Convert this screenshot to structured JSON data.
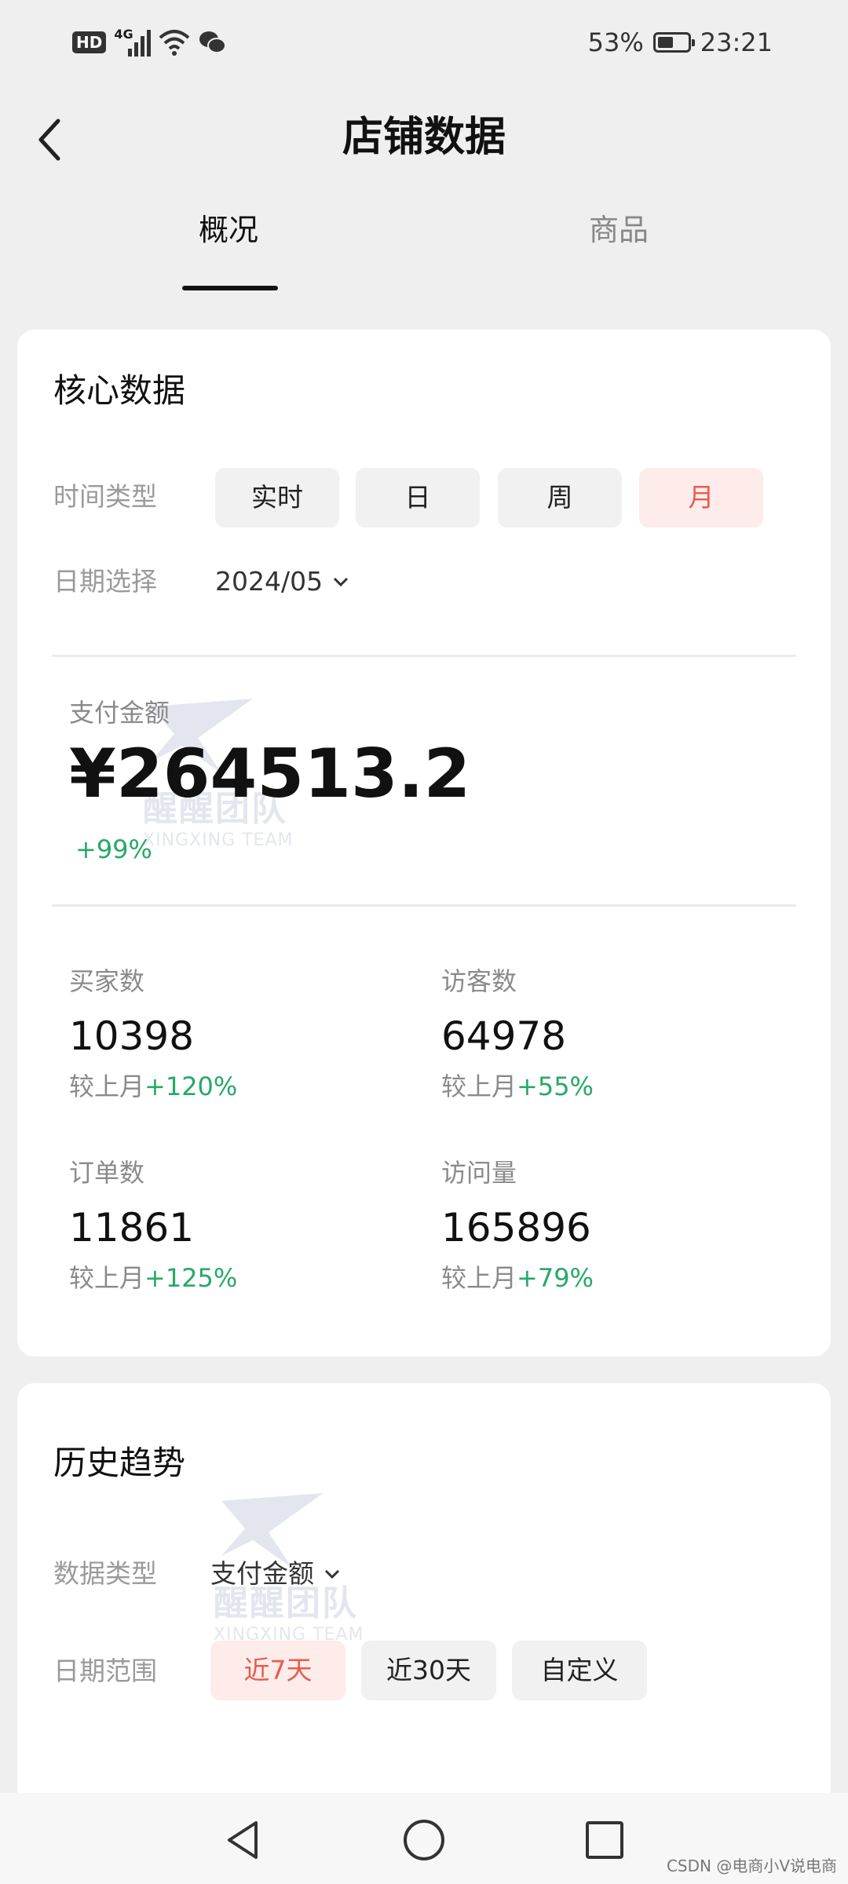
{
  "status": {
    "hd": "HD",
    "net": "4G",
    "battery_pct": "53%",
    "battery_level": 0.53,
    "time": "23:21"
  },
  "nav": {
    "title": "店铺数据"
  },
  "tabs": [
    {
      "label": "概况",
      "active": true
    },
    {
      "label": "商品",
      "active": false
    }
  ],
  "core": {
    "title": "核心数据",
    "time_type_label": "时间类型",
    "time_types": [
      {
        "label": "实时",
        "selected": false
      },
      {
        "label": "日",
        "selected": false
      },
      {
        "label": "周",
        "selected": false
      },
      {
        "label": "月",
        "selected": true
      }
    ],
    "date_label": "日期选择",
    "date_value": "2024/05",
    "pay_label": "支付金额",
    "pay_amount": "¥264513.2",
    "pay_change": "+99%",
    "metrics": [
      {
        "label": "买家数",
        "value": "10398",
        "compare_prefix": "较上月",
        "compare": "+120%"
      },
      {
        "label": "访客数",
        "value": "64978",
        "compare_prefix": "较上月",
        "compare": "+55%"
      },
      {
        "label": "订单数",
        "value": "11861",
        "compare_prefix": "较上月",
        "compare": "+125%"
      },
      {
        "label": "访问量",
        "value": "165896",
        "compare_prefix": "较上月",
        "compare": "+79%"
      }
    ]
  },
  "history": {
    "title": "历史趋势",
    "data_type_label": "数据类型",
    "data_type_value": "支付金额",
    "range_label": "日期范围",
    "ranges": [
      {
        "label": "近7天",
        "selected": true
      },
      {
        "label": "近30天",
        "selected": false
      },
      {
        "label": "自定义",
        "selected": false
      }
    ]
  },
  "watermark": {
    "line1": "醒醒团队",
    "line2": "XINGXING TEAM"
  },
  "credit": "CSDN @电商小V说电商",
  "colors": {
    "accent": "#e65c4f",
    "accent_bg": "#fdecea",
    "positive": "#27a86a"
  }
}
